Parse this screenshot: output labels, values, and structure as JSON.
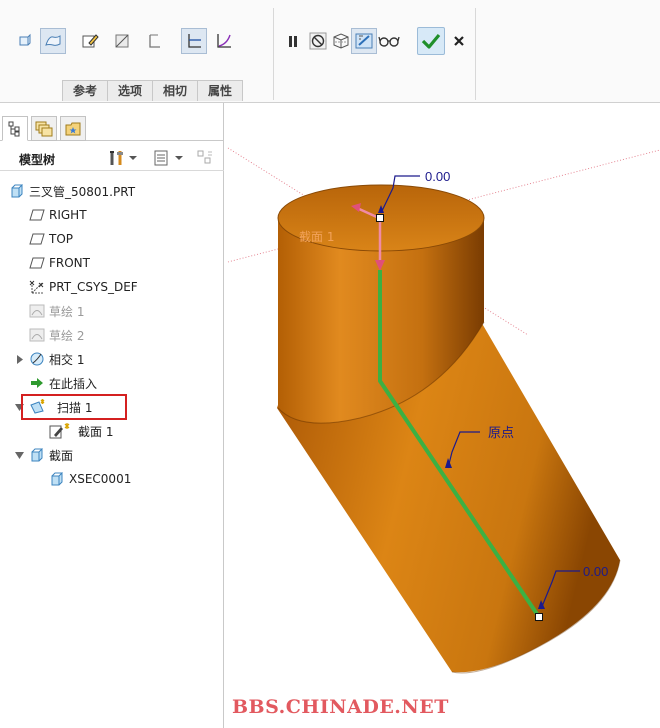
{
  "ribbon": {
    "tabs": [
      "参考",
      "选项",
      "相切",
      "属性"
    ],
    "buttons": {
      "solid": "solid-icon",
      "surface": "surface-icon",
      "edit_section": "sketch-edit-icon",
      "remove_material": "remove-material-icon",
      "thicken": "thicken-icon",
      "constant_section": "constant-section-icon",
      "variable_section": "variable-section-icon",
      "pause": "pause-icon",
      "no_preview": "no-preview-icon",
      "geometry_preview": "geometry-preview-icon",
      "verify": "verify-icon",
      "glasses": "glasses-icon",
      "ok": "check-icon",
      "cancel": "close-icon"
    }
  },
  "panel": {
    "tabs": [
      "model-tree-tab",
      "layer-tree-tab",
      "favorites-tab"
    ],
    "title": "模型树"
  },
  "tree": [
    {
      "label": "三叉管_50801.PRT",
      "icon": "part-icon",
      "dim": false
    },
    {
      "label": "RIGHT",
      "icon": "datum-plane-icon",
      "dim": false
    },
    {
      "label": "TOP",
      "icon": "datum-plane-icon",
      "dim": false
    },
    {
      "label": "FRONT",
      "icon": "datum-plane-icon",
      "dim": false
    },
    {
      "label": "PRT_CSYS_DEF",
      "icon": "csys-icon",
      "dim": false
    },
    {
      "label": "草绘 1",
      "icon": "sketch-icon",
      "dim": true
    },
    {
      "label": "草绘 2",
      "icon": "sketch-icon",
      "dim": true
    },
    {
      "label": "相交 1",
      "icon": "intersect-icon",
      "dim": false
    },
    {
      "label": "在此插入",
      "icon": "insert-here-icon",
      "dim": false
    },
    {
      "label": "扫描 1",
      "icon": "sweep-icon",
      "dim": false
    },
    {
      "label": "截面 1",
      "icon": "section-sketch-icon",
      "dim": false
    },
    {
      "label": "截面",
      "icon": "section-folder-icon",
      "dim": false
    },
    {
      "label": "XSEC0001",
      "icon": "xsec-icon",
      "dim": false
    }
  ],
  "viewport": {
    "section_label": "截面 1",
    "origin_label": "原点",
    "top_value": "0.00",
    "bottom_value": "0.00"
  },
  "watermark": "BBS.CHINADE.NET",
  "colors": {
    "pipe": "#cf7a12",
    "path": "#3cb043",
    "arrow": "#e87a9a",
    "dim_leader": "#1c1a8c",
    "watermark": "#e2595f",
    "highlight": "#d42020"
  }
}
